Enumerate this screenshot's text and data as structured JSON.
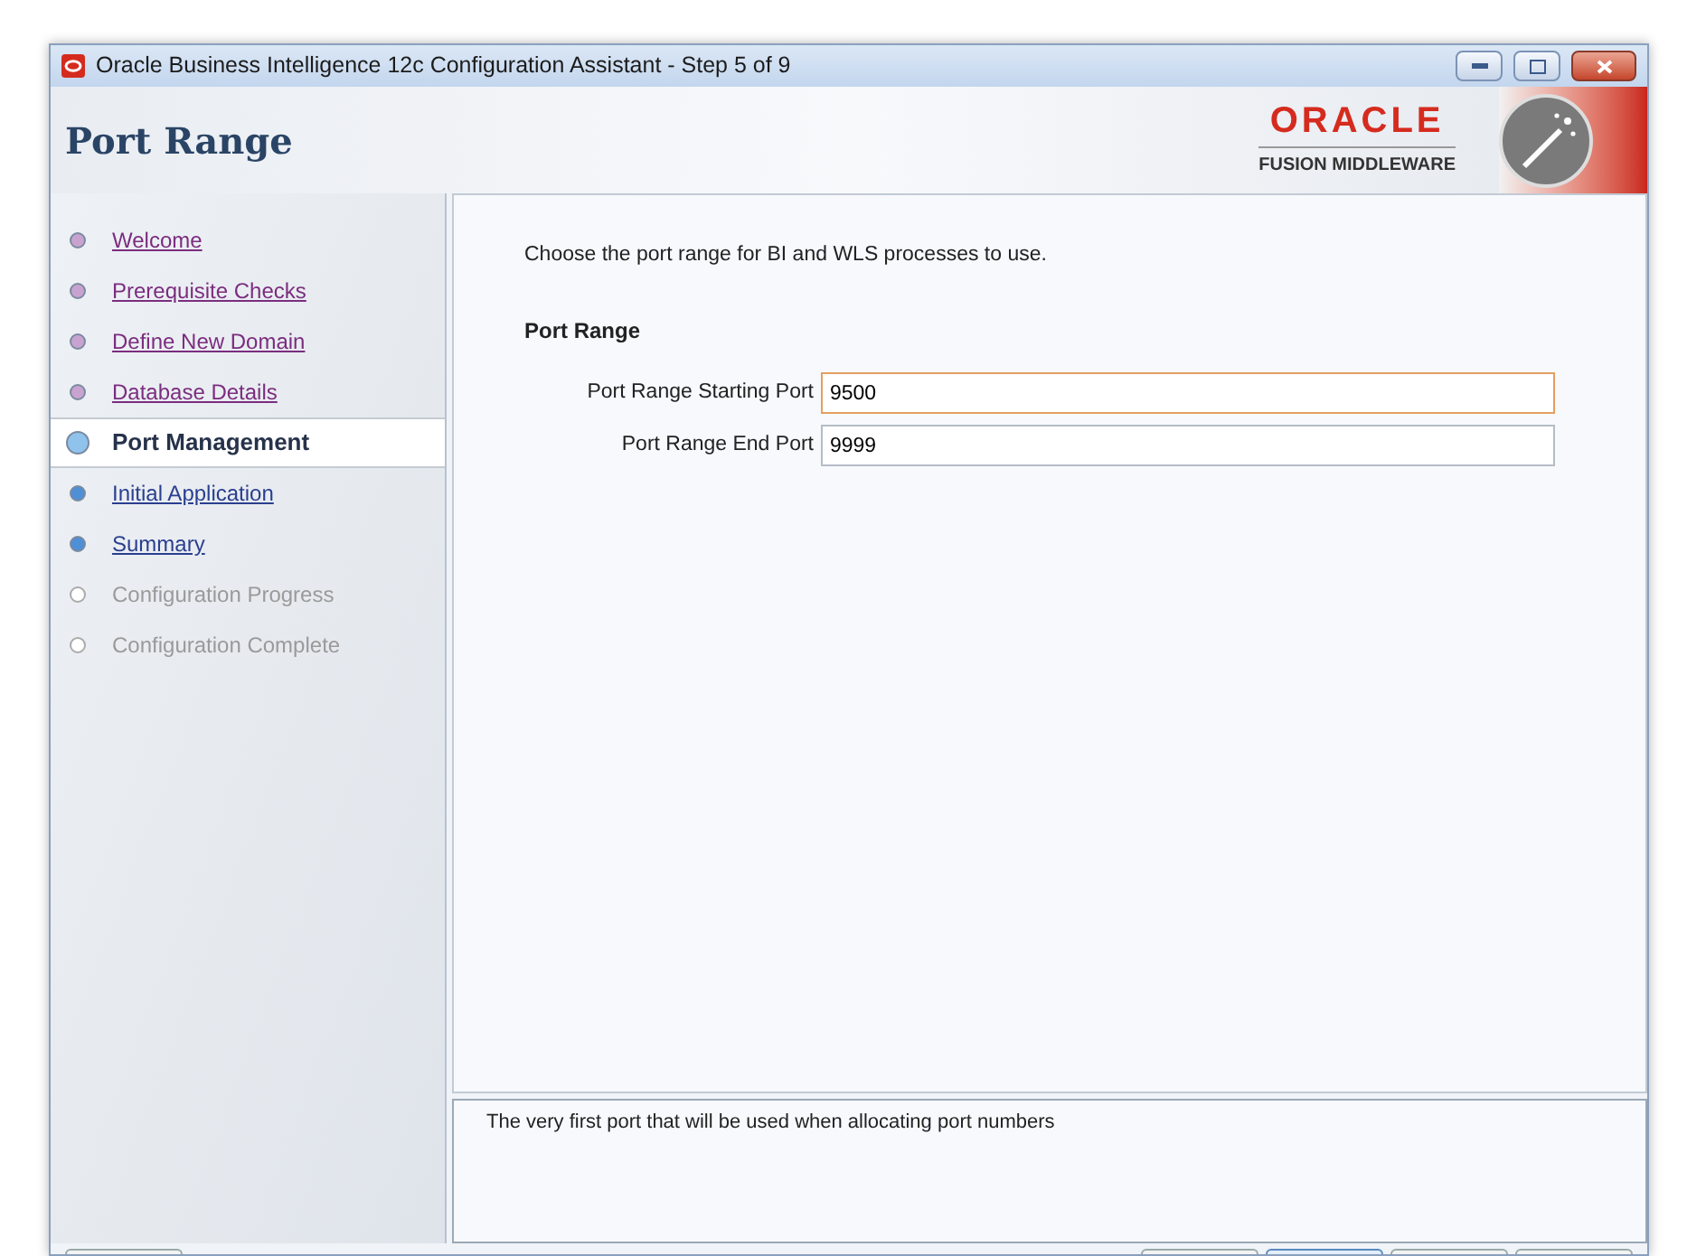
{
  "window": {
    "title": "Oracle Business Intelligence 12c Configuration Assistant - Step 5 of 9"
  },
  "header": {
    "title": "Port Range",
    "brand": "ORACLE",
    "brand_sub": "FUSION MIDDLEWARE"
  },
  "steps": [
    {
      "label": "Welcome",
      "kind": "visited",
      "selected": false
    },
    {
      "label": "Prerequisite Checks",
      "kind": "visited",
      "selected": false
    },
    {
      "label": "Define New Domain",
      "kind": "visited",
      "selected": false
    },
    {
      "label": "Database Details",
      "kind": "visited",
      "selected": false
    },
    {
      "label": "Port Management",
      "kind": "current",
      "selected": true
    },
    {
      "label": "Initial Application",
      "kind": "available",
      "selected": false
    },
    {
      "label": "Summary",
      "kind": "available",
      "selected": false
    },
    {
      "label": "Configuration Progress",
      "kind": "disabled",
      "selected": false
    },
    {
      "label": "Configuration Complete",
      "kind": "disabled",
      "selected": false
    }
  ],
  "content": {
    "intro": "Choose the port range for BI and WLS processes to use.",
    "section": "Port Range",
    "fields": [
      {
        "label": "Port Range Starting Port",
        "value": "9500",
        "focused": true
      },
      {
        "label": "Port Range End Port",
        "value": "9999",
        "focused": false
      }
    ]
  },
  "help": {
    "text": "The very first port that will be used when allocating port numbers"
  }
}
